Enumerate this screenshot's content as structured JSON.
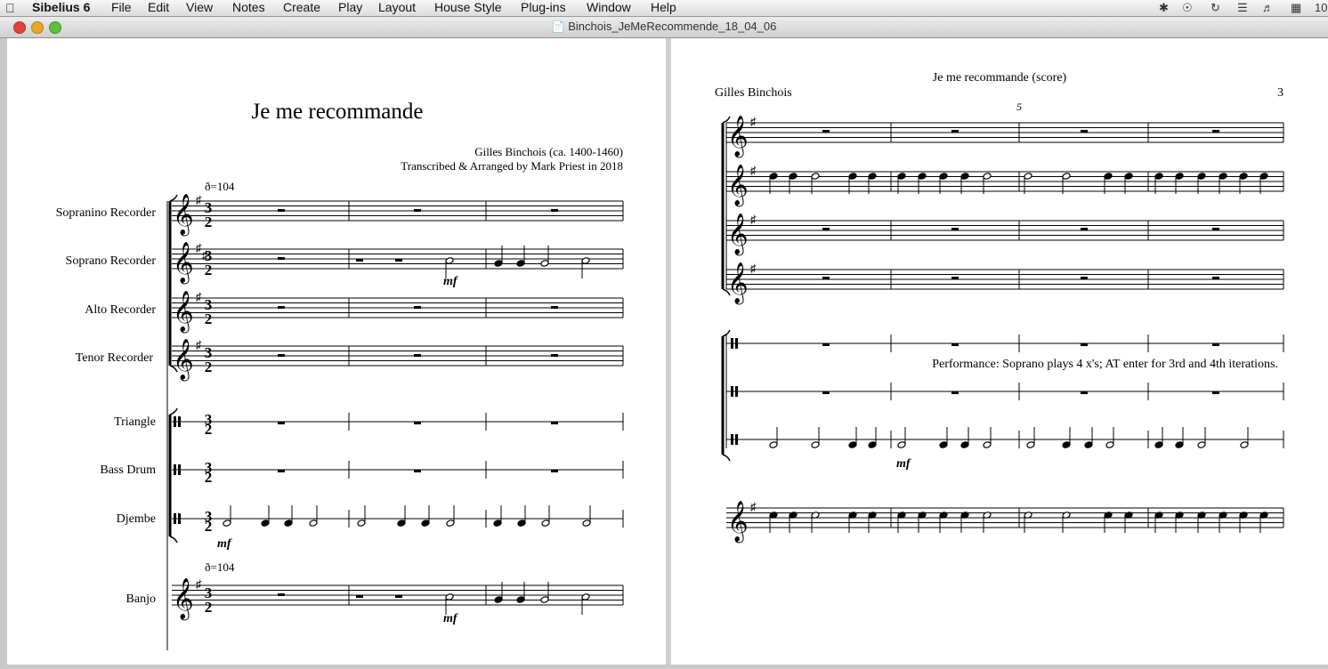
{
  "menubar": {
    "app": "Sibelius 6",
    "items": [
      "File",
      "Edit",
      "View",
      "Notes",
      "Create",
      "Play",
      "Layout",
      "House Style",
      "Plug-ins",
      "Window",
      "Help"
    ],
    "clock": "10"
  },
  "window": {
    "title": "Binchois_JeMeRecommende_18_04_06"
  },
  "page_left": {
    "title": "Je me recommande",
    "composer": "Gilles Binchois (ca. 1400-1460)",
    "arranger": "Transcribed & Arranged by Mark Priest in 2018",
    "tempo": "ð=104",
    "tempo2": "ð=104",
    "time_sig_top": "3",
    "time_sig_bottom": "2",
    "dynamic": "mf",
    "instruments": [
      "Sopranino Recorder",
      "Soprano Recorder",
      "Alto Recorder",
      "Tenor Recorder",
      "Triangle",
      "Bass Drum",
      "Djembe",
      "Banjo"
    ]
  },
  "page_right": {
    "header": "Je me recommande (score)",
    "composer": "Gilles Binchois",
    "page_number": "3",
    "bar_number": "5",
    "dynamic": "mf",
    "performance_note": "Performance: Soprano plays 4 x's; AT enter for 3rd and 4th iterations."
  }
}
